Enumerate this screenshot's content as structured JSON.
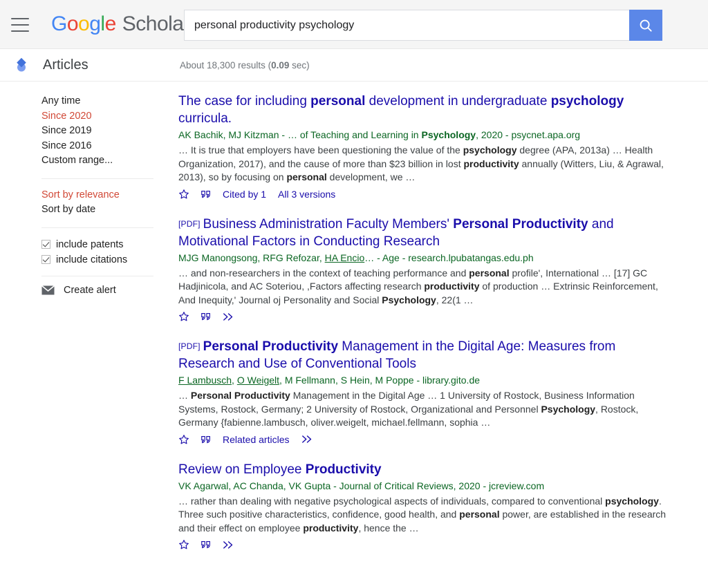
{
  "header": {
    "menu_icon": "hamburger-menu-icon",
    "brand": {
      "g1": "G",
      "o1": "o",
      "o2": "o",
      "g2": "g",
      "l1": "l",
      "e1": "e",
      "scholar": "Scholar"
    },
    "search": {
      "value": "personal productivity psychology",
      "placeholder": "",
      "button_icon": "search-icon"
    }
  },
  "subbar": {
    "logo_icon": "scholar-diamond-icon",
    "title": "Articles",
    "results_prefix": "About 18,300 results (",
    "results_time": "0.09",
    "results_suffix": " sec)"
  },
  "sidebar": {
    "time_filters": [
      {
        "label": "Any time",
        "active": false
      },
      {
        "label": "Since 2020",
        "active": true
      },
      {
        "label": "Since 2019",
        "active": false
      },
      {
        "label": "Since 2016",
        "active": false
      },
      {
        "label": "Custom range...",
        "active": false
      }
    ],
    "sort_filters": [
      {
        "label": "Sort by relevance",
        "active": true
      },
      {
        "label": "Sort by date",
        "active": false
      }
    ],
    "checkboxes": [
      {
        "label": "include patents",
        "checked": true
      },
      {
        "label": "include citations",
        "checked": true
      }
    ],
    "alert": {
      "icon": "envelope-icon",
      "label": "Create alert"
    }
  },
  "results": [
    {
      "pdf_tag": "",
      "title_parts": [
        {
          "text": "The case for including ",
          "bold": false
        },
        {
          "text": "personal",
          "bold": true
        },
        {
          "text": " development in undergraduate ",
          "bold": false
        },
        {
          "text": "psychology",
          "bold": true
        },
        {
          "text": " curricula.",
          "bold": false
        }
      ],
      "authors_parts": [
        {
          "text": "AK Bachik, MJ Kitzman",
          "link": false
        },
        {
          "text": " - … of Teaching and Learning in ",
          "link": false
        },
        {
          "text": "Psychology",
          "link": false,
          "bold": true
        },
        {
          "text": ", 2020 - psycnet.apa.org",
          "link": false
        }
      ],
      "snippet_parts": [
        {
          "text": "… It is true that employers have been questioning the value of the ",
          "bold": false
        },
        {
          "text": "psychology",
          "bold": true
        },
        {
          "text": " degree (APA, 2013a) … Health Organization, 2017), and the cause of more than $23 billion in lost ",
          "bold": false
        },
        {
          "text": "productivity",
          "bold": true
        },
        {
          "text": " annually (Witters, Liu, & Agrawal, 2013), so by focusing on ",
          "bold": false
        },
        {
          "text": "personal",
          "bold": true
        },
        {
          "text": " development, we …",
          "bold": false
        }
      ],
      "actions": {
        "star_icon": "star-outline-icon",
        "quote_icon": "quote-icon",
        "links": [
          "Cited by 1",
          "All 3 versions"
        ],
        "more_icon": ""
      }
    },
    {
      "pdf_tag": "[PDF]",
      "title_parts": [
        {
          "text": "Business Administration Faculty Members' ",
          "bold": false
        },
        {
          "text": "Personal Productivity",
          "bold": true
        },
        {
          "text": " and Motivational Factors in Conducting Research",
          "bold": false
        }
      ],
      "authors_parts": [
        {
          "text": "MJG Manongsong, RFG Refozar, ",
          "link": false
        },
        {
          "text": "HA Encio",
          "link": true
        },
        {
          "text": "… - Age - research.lpubatangas.edu.ph",
          "link": false
        }
      ],
      "snippet_parts": [
        {
          "text": "… and non-researchers in the context of teaching performance and ",
          "bold": false
        },
        {
          "text": "personal",
          "bold": true
        },
        {
          "text": " profile', International … [17] GC Hadjinicola, and AC Soteriou, ,Factors affecting research ",
          "bold": false
        },
        {
          "text": "productivity",
          "bold": true
        },
        {
          "text": " of production … Extrinsic Reinforcement, And Inequity,' Journal oj Personality and Social ",
          "bold": false
        },
        {
          "text": "Psychology",
          "bold": true
        },
        {
          "text": ", 22(1 …",
          "bold": false
        }
      ],
      "actions": {
        "star_icon": "star-outline-icon",
        "quote_icon": "quote-icon",
        "links": [],
        "more_icon": "double-chevron-icon"
      }
    },
    {
      "pdf_tag": "[PDF]",
      "title_parts": [
        {
          "text": "Personal Productivity",
          "bold": true
        },
        {
          "text": " Management in the Digital Age: Measures from Research and Use of Conventional Tools",
          "bold": false
        }
      ],
      "authors_parts": [
        {
          "text": "F Lambusch",
          "link": true
        },
        {
          "text": ", ",
          "link": false
        },
        {
          "text": "O Weigelt",
          "link": true
        },
        {
          "text": ", M Fellmann, S Hein, M Poppe - library.gito.de",
          "link": false
        }
      ],
      "snippet_parts": [
        {
          "text": "… ",
          "bold": false
        },
        {
          "text": "Personal Productivity",
          "bold": true
        },
        {
          "text": " Management in the Digital Age … 1 University of Rostock, Business Information Systems, Rostock, Germany; 2 University of Rostock, Organizational and Personnel ",
          "bold": false
        },
        {
          "text": "Psychology",
          "bold": true
        },
        {
          "text": ", Rostock, Germany {fabienne.lambusch, oliver.weigelt, michael.fellmann, sophia …",
          "bold": false
        }
      ],
      "actions": {
        "star_icon": "star-outline-icon",
        "quote_icon": "quote-icon",
        "links": [
          "Related articles"
        ],
        "more_icon": "double-chevron-icon"
      }
    },
    {
      "pdf_tag": "",
      "title_parts": [
        {
          "text": "Review on Employee ",
          "bold": false
        },
        {
          "text": "Productivity",
          "bold": true
        }
      ],
      "authors_parts": [
        {
          "text": "VK Agarwal, AC Chanda, VK Gupta - Journal of Critical Reviews, 2020 - jcreview.com",
          "link": false
        }
      ],
      "snippet_parts": [
        {
          "text": "… rather than dealing with negative psychological aspects of individuals, compared to conventional ",
          "bold": false
        },
        {
          "text": "psychology",
          "bold": true
        },
        {
          "text": ". Three such positive characteristics, confidence, good health, and ",
          "bold": false
        },
        {
          "text": "personal",
          "bold": true
        },
        {
          "text": " power, are established in the research and their effect on employee ",
          "bold": false
        },
        {
          "text": "productivity",
          "bold": true
        },
        {
          "text": ", hence the …",
          "bold": false
        }
      ],
      "actions": {
        "star_icon": "star-outline-icon",
        "quote_icon": "quote-icon",
        "links": [],
        "more_icon": "double-chevron-icon"
      }
    }
  ],
  "colors": {
    "link_blue": "#1a0dab",
    "author_green": "#0b6623",
    "accent_red": "#d14836",
    "button_blue": "#5b87e8"
  }
}
